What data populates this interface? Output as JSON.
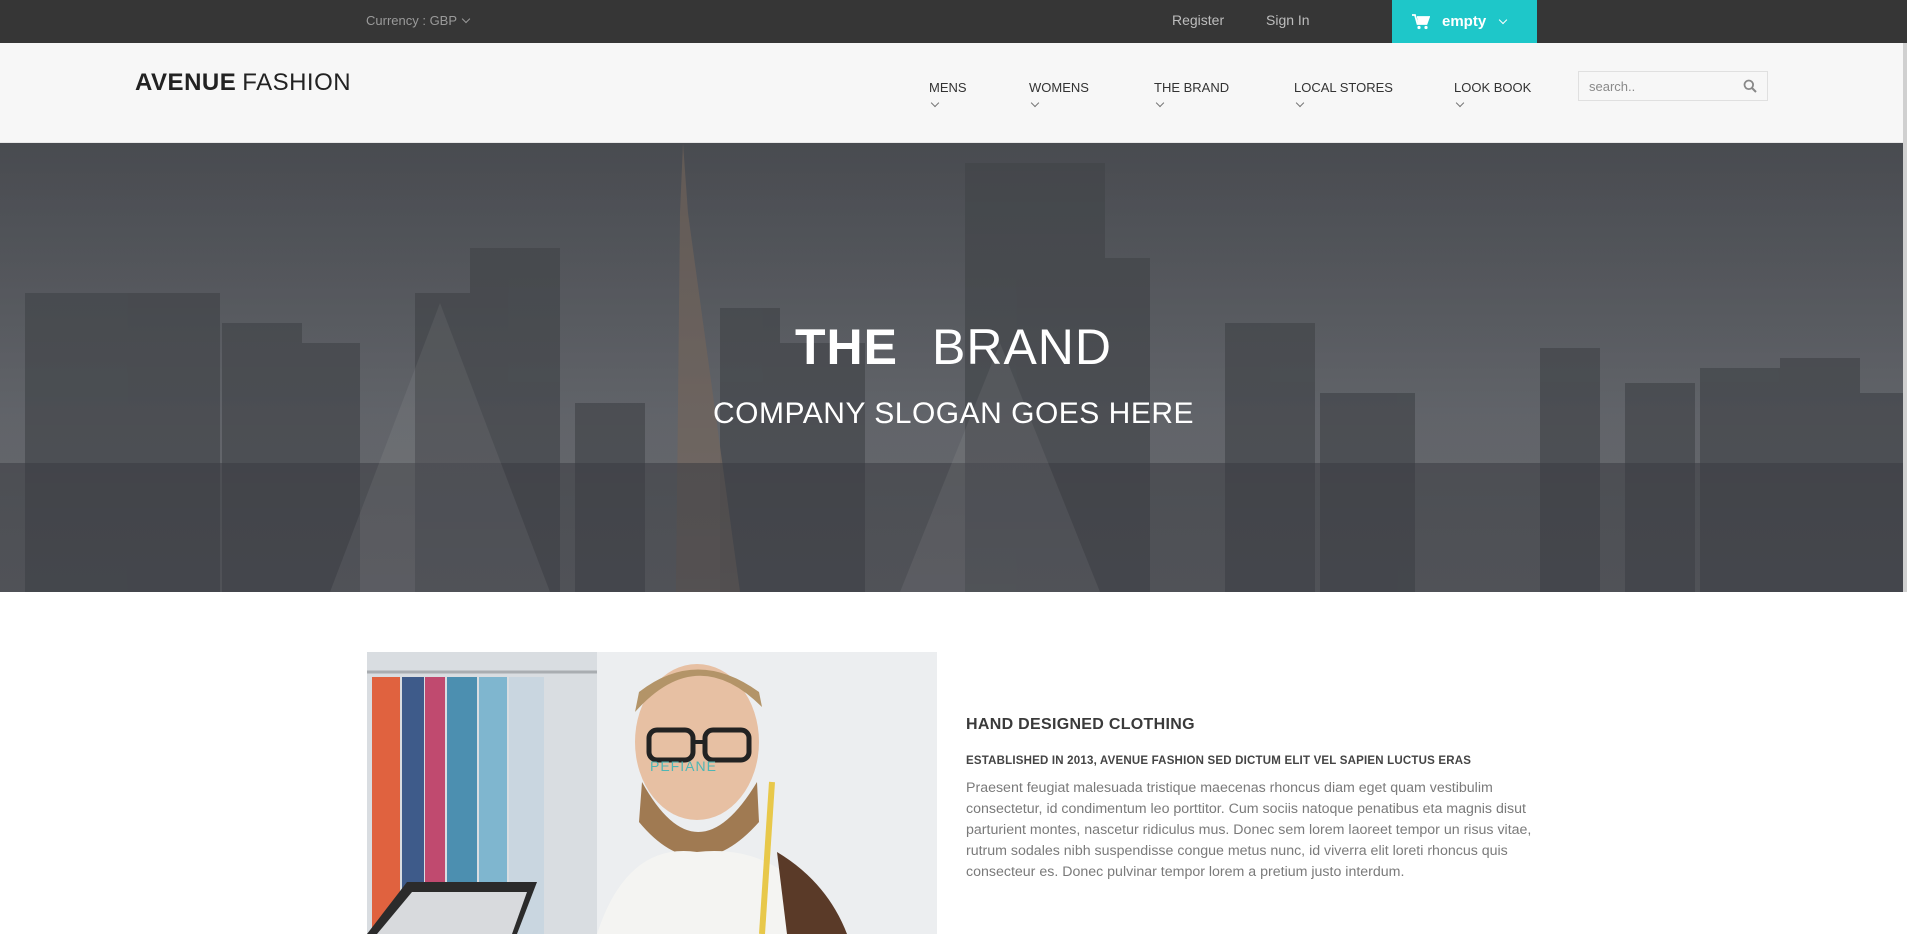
{
  "topbar": {
    "currency_label": "Currency : GBP",
    "register": "Register",
    "sign_in": "Sign In",
    "cart_label": "empty"
  },
  "header": {
    "logo_bold": "AVENUE",
    "logo_light": "FASHION",
    "nav": [
      "MENS",
      "WOMENS",
      "THE BRAND",
      "LOCAL STORES",
      "LOOK BOOK"
    ],
    "search_placeholder": "search.."
  },
  "hero": {
    "title_bold": "THE",
    "title_light": "BRAND",
    "slogan": "COMPANY SLOGAN GOES HERE"
  },
  "content": {
    "photo_label": "PEFIANE",
    "heading": "HAND DESIGNED CLOTHING",
    "subheading": "ESTABLISHED IN 2013, AVENUE FASHION SED DICTUM ELIT VEL SAPIEN LUCTUS ERAS",
    "paragraph": "Praesent feugiat malesuada tristique maecenas rhoncus diam eget quam vestibulim consectetur, id condimentum leo porttitor. Cum sociis natoque penatibus eta magnis disut parturient montes, nascetur ridiculus mus. Donec sem lorem laoreet tempor un risus vitae, rutrum sodales nibh suspendisse congue metus nunc, id viverra elit loreti rhoncus quis consecteur es. Donec pulvinar tempor lorem a pretium justo interdum."
  },
  "colors": {
    "topbar_bg": "#363636",
    "accent": "#1ec7c9",
    "header_bg": "#f7f7f7"
  }
}
